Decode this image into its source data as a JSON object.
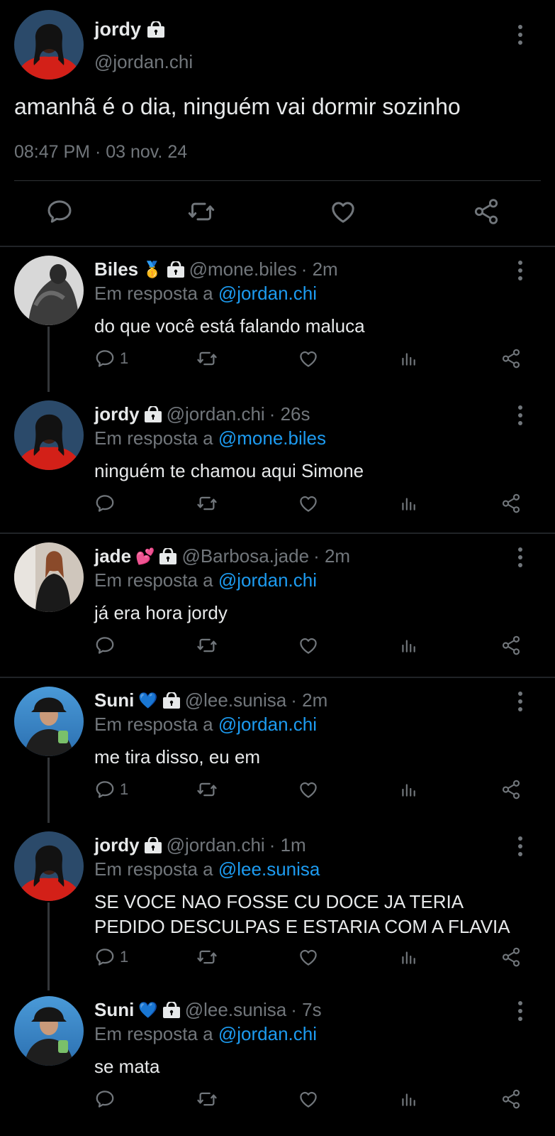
{
  "main_tweet": {
    "name": "jordy",
    "handle": "@jordan.chi",
    "text": "amanhã é o dia, ninguém vai dormir sozinho",
    "timestamp": "08:47 PM · 03 nov. 24",
    "avatar_icon": "avatar-photo",
    "actions": [
      "reply-icon",
      "retweet-icon",
      "like-icon",
      "share-icon"
    ]
  },
  "replies": [
    {
      "name": "Biles",
      "badge": "🥇",
      "handle": "@mone.biles",
      "time": "· 2m",
      "in_reply_prefix": "Em resposta a",
      "in_reply_to": "@jordan.chi",
      "text": "do que você está falando maluca",
      "reply_count": "1"
    },
    {
      "name": "jordy",
      "badge": "",
      "handle": "@jordan.chi",
      "time": "· 26s",
      "in_reply_prefix": "Em resposta a",
      "in_reply_to": "@mone.biles",
      "text": "ninguém te chamou aqui Simone",
      "reply_count": ""
    },
    {
      "name": "jade",
      "badge": "💕",
      "handle": "@Barbosa.jade",
      "time": "· 2m",
      "in_reply_prefix": "Em resposta a",
      "in_reply_to": "@jordan.chi",
      "text": "já era hora jordy",
      "reply_count": ""
    },
    {
      "name": "Suni",
      "badge": "💙",
      "handle": "@lee.sunisa",
      "time": "· 2m",
      "in_reply_prefix": "Em resposta a",
      "in_reply_to": "@jordan.chi",
      "text": "me tira disso, eu em",
      "reply_count": "1"
    },
    {
      "name": "jordy",
      "badge": "",
      "handle": "@jordan.chi",
      "time": "· 1m",
      "in_reply_prefix": "Em resposta a",
      "in_reply_to": "@lee.sunisa",
      "text_line1": "SE VOCE NAO FOSSE CU DOCE JA TERIA",
      "text_line2": "PEDIDO DESCULPAS E ESTARIA COM A FLAVIA",
      "reply_count": "1"
    },
    {
      "name": "Suni",
      "badge": "💙",
      "handle": "@lee.sunisa",
      "time": "· 7s",
      "in_reply_prefix": "Em resposta a",
      "in_reply_to": "@jordan.chi",
      "text": "se mata",
      "reply_count": ""
    }
  ],
  "colors": {
    "background": "#000000",
    "text": "#e7e9ea",
    "muted": "#71767b",
    "link": "#1d9bf0",
    "divider": "#2f3336"
  }
}
